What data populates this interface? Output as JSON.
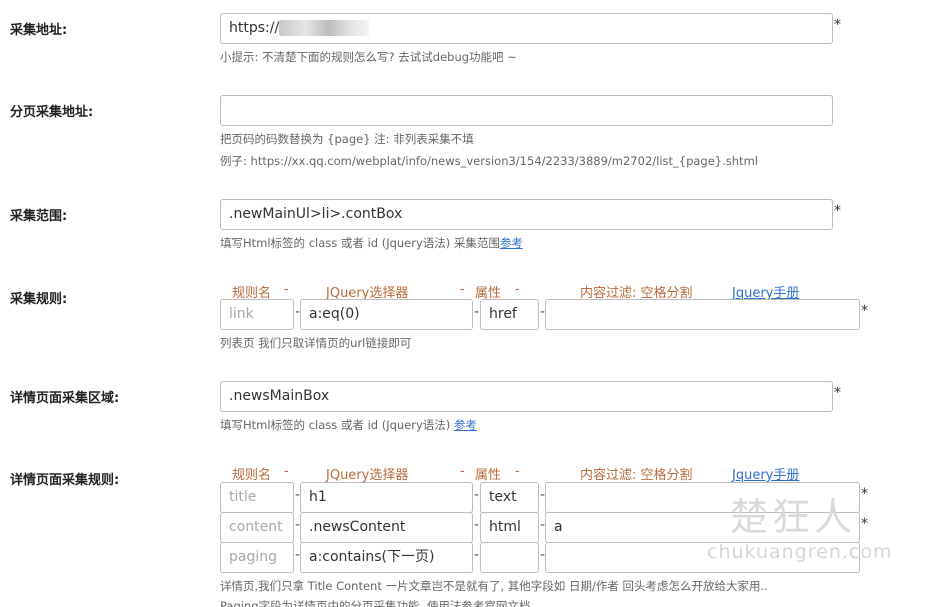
{
  "url_row": {
    "label": "采集地址:",
    "value_prefix": "https://",
    "required_mark": "*",
    "hint": "小提示: 不清楚下面的规则怎么写? 去试试debug功能吧 ~"
  },
  "paging_row": {
    "label": "分页采集地址:",
    "value": "",
    "hint1": "把页码的码数替换为 {page} 注: 非列表采集不填",
    "hint2": "例子: https://xx.qq.com/webplat/info/news_version3/154/2233/3889/m2702/list_{page}.shtml"
  },
  "range_row": {
    "label": "采集范围:",
    "value": ".newMainUl>li>.contBox",
    "required_mark": "*",
    "hint": "填写Html标签的 class 或者 id (Jquery语法) 采集范围",
    "hint_link": "参考"
  },
  "headers": {
    "name": "规则名",
    "selector": "JQuery选择器",
    "attr": "属性",
    "filter": "内容过滤: 空格分割",
    "manual": "Jquery手册",
    "dash": "-"
  },
  "list_rules": {
    "label": "采集规则:",
    "rows": [
      {
        "name": "link",
        "selector": "a:eq(0)",
        "attr": "href",
        "filter": "",
        "required_mark": "*"
      }
    ],
    "hint": "列表页 我们只取详情页的url链接即可"
  },
  "detail_area": {
    "label": "详情页面采集区域:",
    "value": ".newsMainBox",
    "required_mark": "*",
    "hint": "填写Html标签的 class 或者 id (Jquery语法)",
    "hint_link": "参考"
  },
  "detail_rules": {
    "label": "详情页面采集规则:",
    "rows": [
      {
        "name": "title",
        "selector": "h1",
        "attr": "text",
        "filter": "",
        "required_mark": "*"
      },
      {
        "name": "content",
        "selector": ".newsContent",
        "attr": "html",
        "filter": "a",
        "required_mark": "*"
      },
      {
        "name": "paging",
        "selector": "a:contains(下一页)",
        "attr": "",
        "filter": "",
        "required_mark": ""
      }
    ],
    "hint1": "详情页,我们只拿 Title Content 一片文章岂不是就有了, 其他字段如 日期/作者 回头考虑怎么开放给大家用..",
    "hint2": "Paging字段为详情页中的分页采集功能, 使用法参考官网文档"
  },
  "watermark": {
    "cn": "楚狂人",
    "en": "chukuangren.com"
  }
}
